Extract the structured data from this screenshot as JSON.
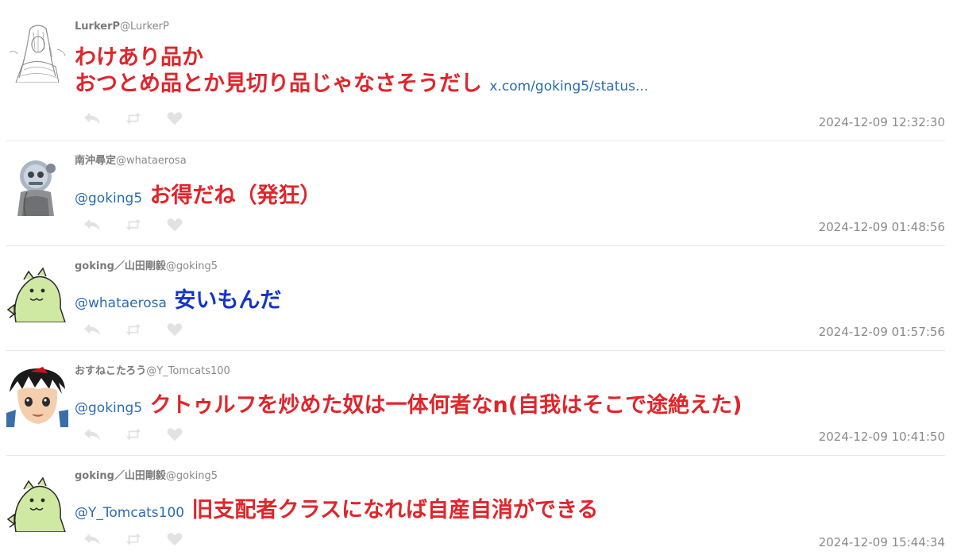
{
  "tweets": [
    {
      "user_name": "LurkerP",
      "handle": "@LurkerP",
      "text_lines": [
        "わけあり品か",
        "おつとめ品とか見切り品じゃなさそうだし"
      ],
      "link": "x.com/goking5/status...",
      "timestamp": "2024-12-09 12:32:30",
      "avatar_icon": "sketch-girl-avatar"
    },
    {
      "user_name": "南沖尋定",
      "handle": "@whataerosa",
      "mention": "@goking5",
      "text": "お得だね（発狂）",
      "timestamp": "2024-12-09 01:48:56",
      "avatar_icon": "mascot-figure-avatar"
    },
    {
      "user_name": "goking／山田剛毅",
      "handle": "@goking5",
      "mention": "@whataerosa",
      "text": "安いもんだ",
      "timestamp": "2024-12-09 01:57:56",
      "avatar_icon": "green-creature-avatar"
    },
    {
      "user_name": "おすねこたろう",
      "handle": "@Y_Tomcats100",
      "mention": "@goking5",
      "text": "クトゥルフを炒めた奴は一体何者なn(自我はそこで途絶えた)",
      "timestamp": "2024-12-09 10:41:50",
      "avatar_icon": "anime-boy-avatar"
    },
    {
      "user_name": "goking／山田剛毅",
      "handle": "@goking5",
      "mention": "@Y_Tomcats100",
      "text": "旧支配者クラスになれば自産自消ができる",
      "timestamp": "2024-12-09 15:44:34",
      "avatar_icon": "green-creature-avatar"
    }
  ],
  "action_icons": [
    "reply-icon",
    "retweet-icon",
    "like-icon"
  ],
  "colors": {
    "red_text": "#e0252b",
    "blue_text": "#1535c8",
    "link": "#2b6cb0",
    "meta_gray": "#8a8a8a",
    "action_icon": "#e2e2e2"
  }
}
